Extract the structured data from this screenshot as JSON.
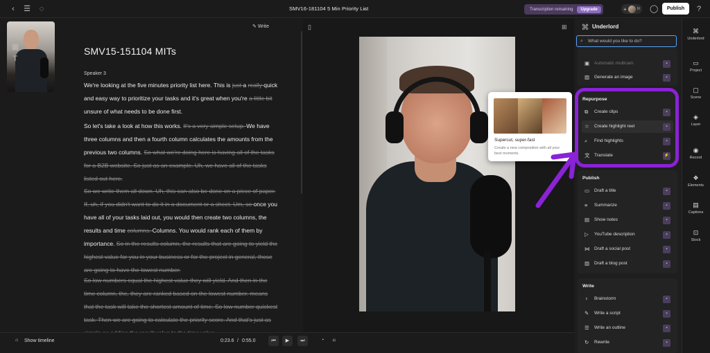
{
  "topbar": {
    "doc_title": "SMV16-181104 5 Min Priority List",
    "transcription_label": "Transcription remaining",
    "upgrade_label": "Upgrade",
    "avatar_initial": "M",
    "publish_label": "Publish"
  },
  "editor": {
    "write_label": "Write",
    "title": "SMV15-151104 MITs",
    "speaker": "Speaker 3",
    "p1": [
      {
        "t": "We're looking at the five minutes priority list here. This is ",
        "s": false
      },
      {
        "t": "just ",
        "s": true
      },
      {
        "t": "a ",
        "s": false
      },
      {
        "t": "really ",
        "s": true
      },
      {
        "t": "quick and easy way to prioritize your tasks and it's great when you're ",
        "s": false
      },
      {
        "t": "a little bit ",
        "s": true
      },
      {
        "t": "unsure of what needs to be done first.",
        "s": false
      }
    ],
    "p2": [
      {
        "t": "So let's take a look at how this works. ",
        "s": false
      },
      {
        "t": "It's a very simple setup. ",
        "s": true
      },
      {
        "t": "We have three columns and then a fourth column calculates the amounts from the previous two columns. ",
        "s": false
      },
      {
        "t": "So what we're doing here is having all of the tasks for a B2B website. So just as an example. Uh, we have all of the tasks listed out here.",
        "s": true
      }
    ],
    "p3": [
      {
        "t": "So we write them all down. Uh, this can also be done on a piece of paper. If, uh, if you didn't want to do it in a document or a sheet. Um, so ",
        "s": true
      },
      {
        "t": "once you have all of your tasks laid out, you would then create two columns, the results and time ",
        "s": false
      },
      {
        "t": "columns. ",
        "s": true
      },
      {
        "t": "Columns. You would rank each of them by importance. ",
        "s": false
      },
      {
        "t": "So in the results column, the results that are going to yield the highest value for you in your business or for the project in general, those are going to have the lowest number.",
        "s": true
      }
    ],
    "p4": [
      {
        "t": "So low numbers equal the highest value they will yield. And then in the time column, the, they are ranked based on the lowest number. means that the task will take the shortest amount of time. So low number quickest task. Then we are going to calculate the priority score. And that's just as simple as adding the result value to the time value.",
        "s": true
      }
    ]
  },
  "bottom": {
    "show_timeline": "Show timeline",
    "current_time": "0:23.6",
    "separator": "/",
    "total_time": "0:55.0"
  },
  "underlord": {
    "title": "Underlord",
    "search_placeholder": "What would you like to do?",
    "top_items": [
      "Automatic multicam",
      "Generate an image"
    ],
    "repurpose": {
      "heading": "Repurpose",
      "items": [
        "Create clips",
        "Create highlight reel",
        "Find highlights",
        "Translate"
      ]
    },
    "publish": {
      "heading": "Publish",
      "items": [
        "Draft a title",
        "Summarize",
        "Show notes",
        "YouTube description",
        "Draft a social post",
        "Draft a blog post"
      ]
    },
    "write": {
      "heading": "Write",
      "items": [
        "Brainstorm",
        "Write a script",
        "Write an outline",
        "Rewrite"
      ]
    }
  },
  "tooltip": {
    "title": "Supercut, super-fast",
    "description": "Create a new composition with all your best moments"
  },
  "rail": [
    "Underlord",
    "Project",
    "Scene",
    "Layer",
    "Record",
    "Elements",
    "Captions",
    "Stock"
  ],
  "colors": {
    "accent_purple": "#8a22d6",
    "publish_bg": "#ffffff",
    "search_border": "#5aa4ff"
  }
}
